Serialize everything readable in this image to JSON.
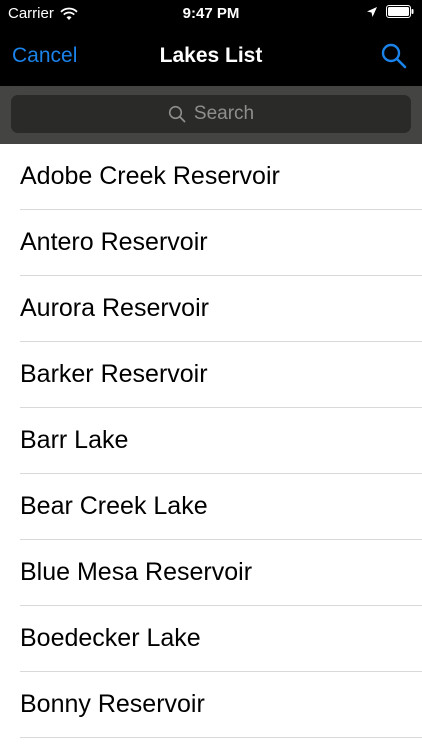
{
  "status_bar": {
    "carrier": "Carrier",
    "time": "9:47 PM"
  },
  "nav": {
    "cancel_label": "Cancel",
    "title": "Lakes List"
  },
  "search": {
    "placeholder": "Search"
  },
  "lakes": [
    "Adobe Creek Reservoir",
    "Antero Reservoir",
    "Aurora Reservoir",
    "Barker Reservoir",
    "Barr Lake",
    "Bear Creek Lake",
    "Blue Mesa Reservoir",
    "Boedecker Lake",
    "Bonny Reservoir"
  ],
  "colors": {
    "accent": "#1a82e8",
    "bar_background": "#000000",
    "search_area": "#444442"
  },
  "icons": {
    "wifi": "wifi-icon",
    "location": "location-arrow-icon",
    "battery": "battery-icon",
    "search": "search-icon"
  }
}
